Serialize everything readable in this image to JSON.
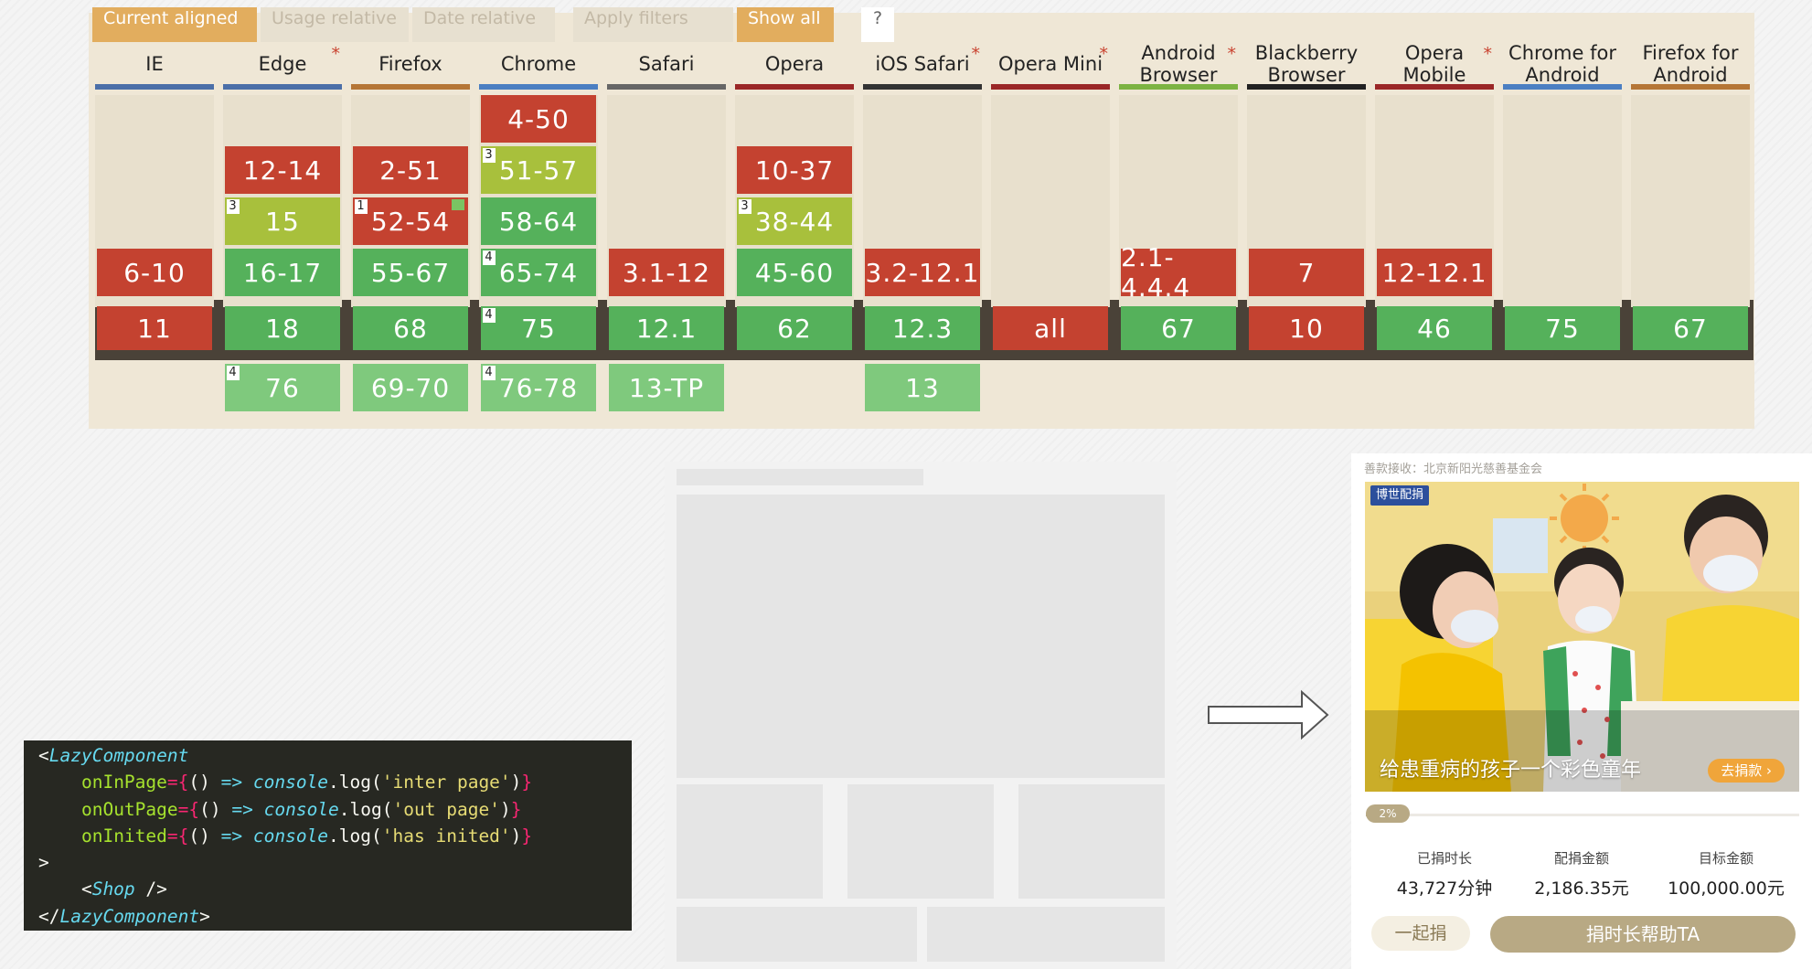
{
  "filters": {
    "current_aligned": "Current aligned",
    "usage_relative": "Usage relative",
    "date_relative": "Date relative",
    "apply_filters": "Apply filters",
    "show_all": "Show all",
    "help": "?"
  },
  "browsers": [
    {
      "name": "IE",
      "star": "",
      "color": "#4b6fa8",
      "cells": {
        "prev3": "",
        "prev2": "",
        "prev1": "",
        "prev0": "6-10",
        "current": "11",
        "future": ""
      },
      "notes": {}
    },
    {
      "name": "Edge",
      "star": "*",
      "color": "#4b6fa8",
      "cells": {
        "prev3": "",
        "prev2": "12-14",
        "prev1": "15",
        "prev0": "16-17",
        "current": "18",
        "future": "76"
      },
      "notes": {
        "prev1": "3",
        "future": "4"
      }
    },
    {
      "name": "Firefox",
      "star": "",
      "color": "#b57636",
      "cells": {
        "prev3": "",
        "prev2": "2-51",
        "prev1": "52-54",
        "prev0": "55-67",
        "current": "68",
        "future": "69-70"
      },
      "notes": {
        "prev1": "1"
      }
    },
    {
      "name": "Chrome",
      "star": "",
      "color": "#4b7fc2",
      "cells": {
        "prev3": "4-50",
        "prev2": "51-57",
        "prev1": "58-64",
        "prev0": "65-74",
        "current": "75",
        "future": "76-78"
      },
      "notes": {
        "prev2": "3",
        "prev0": "4",
        "current": "4",
        "future": "4"
      }
    },
    {
      "name": "Safari",
      "star": "",
      "color": "#666666",
      "cells": {
        "prev3": "",
        "prev2": "",
        "prev1": "",
        "prev0": "3.1-12",
        "current": "12.1",
        "future": "13-TP"
      },
      "notes": {}
    },
    {
      "name": "Opera",
      "star": "",
      "color": "#9a2727",
      "cells": {
        "prev3": "",
        "prev2": "10-37",
        "prev1": "38-44",
        "prev0": "45-60",
        "current": "62",
        "future": ""
      },
      "notes": {
        "prev1": "3"
      }
    },
    {
      "name": "iOS Safari",
      "star": "*",
      "color": "#333333",
      "cells": {
        "prev3": "",
        "prev2": "",
        "prev1": "",
        "prev0": "3.2-12.1",
        "current": "12.3",
        "future": "13"
      },
      "notes": {}
    },
    {
      "name": "Opera Mini",
      "star": "*",
      "color": "#9a2727",
      "cells": {
        "prev3": "",
        "prev2": "",
        "prev1": "",
        "prev0": "",
        "current": "all",
        "future": ""
      },
      "notes": {}
    },
    {
      "name": "Android Browser",
      "star": "*",
      "color": "#7cb342",
      "cells": {
        "prev3": "",
        "prev2": "",
        "prev1": "",
        "prev0": "2.1-4.4.4",
        "current": "67",
        "future": ""
      },
      "notes": {}
    },
    {
      "name": "Blackberry Browser",
      "star": "",
      "color": "#222222",
      "cells": {
        "prev3": "",
        "prev2": "",
        "prev1": "",
        "prev0": "7",
        "current": "10",
        "future": ""
      },
      "notes": {}
    },
    {
      "name": "Opera Mobile",
      "star": "*",
      "color": "#9a2727",
      "cells": {
        "prev3": "",
        "prev2": "",
        "prev1": "",
        "prev0": "12-12.1",
        "current": "46",
        "future": ""
      },
      "notes": {}
    },
    {
      "name": "Chrome for Android",
      "star": "",
      "color": "#4b7fc2",
      "cells": {
        "prev3": "",
        "prev2": "",
        "prev1": "",
        "prev0": "",
        "current": "75",
        "future": ""
      },
      "notes": {}
    },
    {
      "name": "Firefox for Android",
      "star": "",
      "color": "#b57636",
      "cells": {
        "prev3": "",
        "prev2": "",
        "prev1": "",
        "prev0": "",
        "current": "67",
        "future": ""
      },
      "notes": {}
    }
  ],
  "support_colors": {
    "supported": "#55b15b",
    "unsupported": "#c44230",
    "partial": "#a8c03c",
    "future": "#7fc97d"
  },
  "code": {
    "open_tag": "LazyComponent",
    "line_inpage_attr": "onInPage",
    "line_inpage_str": "'inter page'",
    "line_outpage_attr": "onOutPage",
    "line_outpage_str": "'out page'",
    "line_inited_attr": "onInited",
    "line_inited_str": "'has inited'",
    "console": "console",
    "log": "log",
    "child_tag": "Shop",
    "close_tag": "LazyComponent"
  },
  "card": {
    "recipient": "善款接收：北京新阳光慈善基金会",
    "badge": "博世配捐",
    "caption": "给患重病的孩子一个彩色童年",
    "donate_pill": "去捐款 ›",
    "progress_label": "2%",
    "progress_fraction": 0.02,
    "stats": [
      {
        "label": "已捐时长",
        "value": "43,727分钟"
      },
      {
        "label": "配捐金额",
        "value": "2,186.35元"
      },
      {
        "label": "目标金额",
        "value": "100,000.00元"
      }
    ],
    "together_button": "一起捐",
    "help_button": "捐时长帮助TA"
  }
}
